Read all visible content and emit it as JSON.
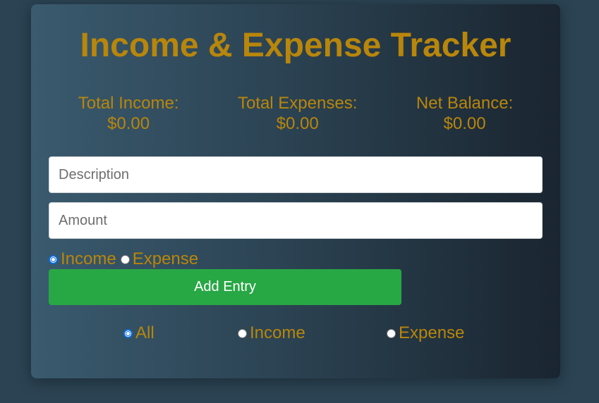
{
  "app": {
    "title": "Income & Expense Tracker"
  },
  "totals": [
    {
      "label": "Total Income:",
      "value": "$0.00"
    },
    {
      "label": "Total Expenses:",
      "value": "$0.00"
    },
    {
      "label": "Net Balance:",
      "value": "$0.00"
    }
  ],
  "form": {
    "description_placeholder": "Description",
    "description_value": "",
    "amount_placeholder": "Amount",
    "amount_value": "",
    "type_options": [
      {
        "label": "Income",
        "checked": true
      },
      {
        "label": "Expense",
        "checked": false
      }
    ],
    "submit_label": "Add Entry"
  },
  "filter": {
    "options": [
      {
        "label": "All",
        "checked": true
      },
      {
        "label": "Income",
        "checked": false
      },
      {
        "label": "Expense",
        "checked": false
      }
    ]
  },
  "colors": {
    "accent": "#b8860b",
    "button": "#28a745",
    "radio_selected": "#0b6cd8"
  }
}
